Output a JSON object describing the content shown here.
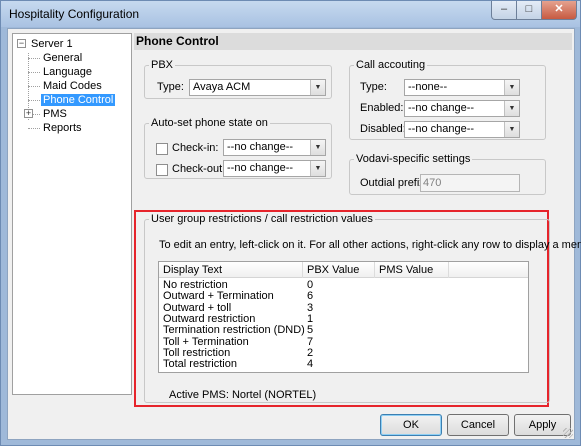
{
  "window": {
    "title": "Hospitality Configuration",
    "min_label": "–",
    "max_label": "□",
    "close_label": "✕"
  },
  "tree": {
    "root": "Server 1",
    "items": [
      "General",
      "Language",
      "Maid Codes",
      "Phone Control",
      "PMS",
      "Reports"
    ],
    "selected": "Phone Control",
    "root_expander": "−",
    "pms_expander": "+"
  },
  "header": {
    "title": "Phone Control"
  },
  "pbx": {
    "legend": "PBX",
    "type_label": "Type:",
    "type_value": "Avaya ACM"
  },
  "autoset": {
    "legend": "Auto-set phone state on",
    "checkin_label": "Check-in:",
    "checkin_value": "--no change--",
    "checkout_label": "Check-out:",
    "checkout_value": "--no change--"
  },
  "call_accounting": {
    "legend": "Call accouting",
    "type_label": "Type:",
    "type_value": "--none--",
    "enabled_label": "Enabled:",
    "enabled_value": "--no change--",
    "disabled_label": "Disabled:",
    "disabled_value": "--no change--"
  },
  "vodavi": {
    "legend": "Vodavi-specific settings",
    "outdial_label": "Outdial prefix:",
    "outdial_value": "470"
  },
  "restrictions": {
    "legend": "User group restrictions / call restriction values",
    "instructions": "To edit an entry, left-click on it.  For all other actions, right-click any row to display a menu.",
    "columns": [
      "Display Text",
      "PBX Value",
      "PMS Value"
    ],
    "rows": [
      {
        "text": "No restriction",
        "pbx": "0",
        "pms": ""
      },
      {
        "text": "Outward + Termination",
        "pbx": "6",
        "pms": ""
      },
      {
        "text": "Outward + toll",
        "pbx": "3",
        "pms": ""
      },
      {
        "text": "Outward restriction",
        "pbx": "1",
        "pms": ""
      },
      {
        "text": "Termination restriction (DND)",
        "pbx": "5",
        "pms": ""
      },
      {
        "text": "Toll + Termination",
        "pbx": "7",
        "pms": ""
      },
      {
        "text": "Toll restriction",
        "pbx": "2",
        "pms": ""
      },
      {
        "text": "Total restriction",
        "pbx": "4",
        "pms": ""
      }
    ],
    "active_pms": "Active PMS:  Nortel (NORTEL)"
  },
  "buttons": {
    "ok": "OK",
    "cancel": "Cancel",
    "apply": "Apply"
  },
  "colors": {
    "highlight": "#e6242b",
    "selection": "#3399ff",
    "title_bar": "#c6d9ef"
  },
  "icons": {
    "dropdown": "chevron-down-icon"
  }
}
